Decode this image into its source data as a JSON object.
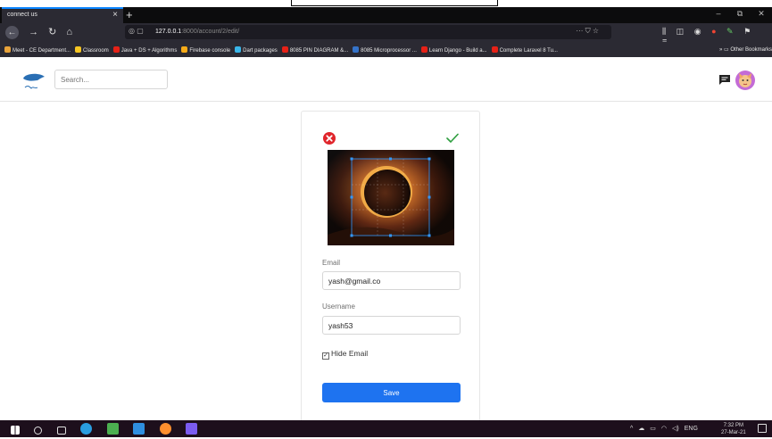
{
  "browser": {
    "tab_title": "connect us",
    "tab_close": "×",
    "new_tab": "+",
    "url_host": "127.0.0.1",
    "url_rest": ":8000/account/2/edit/",
    "window_min": "–",
    "window_max": "⧉",
    "window_close": "✕"
  },
  "bookmarks": [
    {
      "label": "Meet - CE Department...",
      "color": "#e8a33a"
    },
    {
      "label": "Classroom",
      "color": "#f7c623"
    },
    {
      "label": "Java + DS + Algorithms",
      "color": "#e62117"
    },
    {
      "label": "Firebase console",
      "color": "#f6ab18"
    },
    {
      "label": "Dart packages",
      "color": "#39b6e9"
    },
    {
      "label": "8085 PIN DIAGRAM &...",
      "color": "#e62117"
    },
    {
      "label": "8085 Microprocessor ...",
      "color": "#3573c9"
    },
    {
      "label": "Learn Django - Build a...",
      "color": "#e62117"
    },
    {
      "label": "Complete Laravel 8 Tu...",
      "color": "#e62117"
    }
  ],
  "other_bookmarks": "Other Bookmarks",
  "header": {
    "search_placeholder": "Search..."
  },
  "form": {
    "email_label": "Email",
    "email_value": "yash@gmail.co",
    "username_label": "Username",
    "username_value": "yash53",
    "hide_email_label": "Hide Email",
    "save_label": "Save"
  },
  "taskbar": {
    "lang": "ENG",
    "time": "7:32 PM",
    "date": "27-Mar-21"
  },
  "colors": {
    "accent": "#1e73f0",
    "cancel": "#e0252b",
    "confirm": "#2e9e3f",
    "taskbar": "#1d0f1c"
  }
}
